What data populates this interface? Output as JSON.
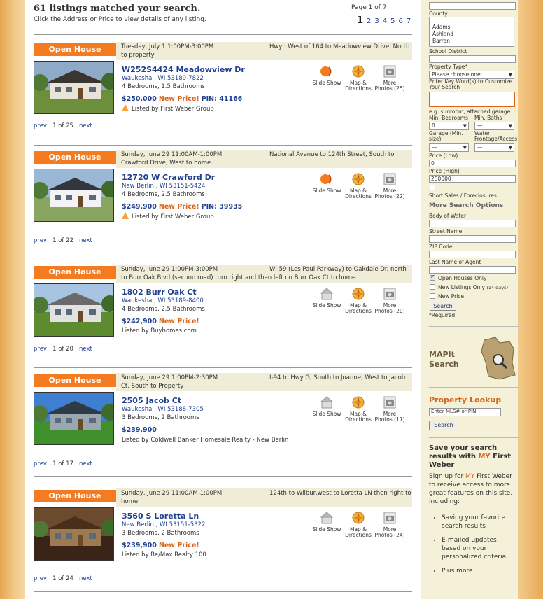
{
  "results": {
    "heading": "61 listings matched your search.",
    "instructions": "Click the Address or Price to view details of any listing.",
    "page_label": "Page 1 of 7",
    "pages": [
      "1",
      "2",
      "3",
      "4",
      "5",
      "6",
      "7"
    ],
    "current_page": "1"
  },
  "icons": {
    "slide_show": "Slide Show",
    "map": "Map & Directions",
    "more": "More Photos"
  },
  "listings": [
    {
      "badge": "Open House",
      "date": "Tuesday, July 1 1:00PM-3:00PM",
      "directions": "Hwy I West of 164 to Meadowview Drive, North to property",
      "address": "W252S4424 Meadowview Dr",
      "city": "Waukesha , WI 53189-7822",
      "beds": "4 Bedrooms, 1.5 Bathrooms",
      "price": "$250,000",
      "new_price": "New Price!",
      "pin": "PIN: 41166",
      "listed_by": "Listed by First Weber Group",
      "photo_count": "(25)",
      "prev": "prev",
      "count": "1 of 25",
      "next": "next"
    },
    {
      "badge": "Open House",
      "date": "Sunday, June 29 11:00AM-1:00PM",
      "directions": "National Avenue to 124th Street, South to Crawford Drive, West to home.",
      "address": "12720 W Crawford Dr",
      "city": "New Berlin , WI 53151-5424",
      "beds": "4 Bedrooms, 2.5 Bathrooms",
      "price": "$249,900",
      "new_price": "New Price!",
      "pin": "PIN: 39935",
      "listed_by": "Listed by First Weber Group",
      "photo_count": "(22)",
      "prev": "prev",
      "count": "1 of 22",
      "next": "next"
    },
    {
      "badge": "Open House",
      "date": "Sunday, June 29 1:00PM-3:00PM",
      "directions": "WI 59 (Les Paul Parkway) to Oakdale Dr. north to Burr Oak Blvd (second road) turn right and then left on Burr Oak Ct to home.",
      "address": "1802 Burr Oak Ct",
      "city": "Waukesha , WI 53189-8400",
      "beds": "4 Bedrooms, 2.5 Bathrooms",
      "price": "$242,900",
      "new_price": "New Price!",
      "pin": "",
      "listed_by": "Listed by Buyhomes.com",
      "photo_count": "(20)",
      "prev": "prev",
      "count": "1 of 20",
      "next": "next"
    },
    {
      "badge": "Open House",
      "date": "Sunday, June 29 1:00PM-2:30PM",
      "directions": "I-94 to Hwy G, South to Joanne, West to Jacob Ct, South to Property",
      "address": "2505 Jacob Ct",
      "city": "Waukesha , WI 53188-7305",
      "beds": "3 Bedrooms, 2 Bathrooms",
      "price": "$239,900",
      "new_price": "",
      "pin": "",
      "listed_by": "Listed by Coldwell Banker Homesale Realty - New Berlin",
      "photo_count": "(17)",
      "prev": "prev",
      "count": "1 of 17",
      "next": "next"
    },
    {
      "badge": "Open House",
      "date": "Sunday, June 29 11:00AM-1:00PM",
      "directions": "124th to Wilbur,west to Loretta LN then right to home.",
      "address": "3560 S Loretta Ln",
      "city": "New Berlin , WI 53151-5322",
      "beds": "3 Bedrooms, 2 Bathrooms",
      "price": "$239,900",
      "new_price": "New Price!",
      "pin": "",
      "listed_by": "Listed by Re/Max Realty 100",
      "photo_count": "(24)",
      "prev": "prev",
      "count": "1 of 24",
      "next": "next"
    }
  ],
  "sidebar": {
    "county_label": "County",
    "counties": [
      "Adams",
      "Ashland",
      "Barron"
    ],
    "school_label": "School District",
    "type_label": "Property Type*",
    "type_value": "Please choose one:",
    "keyword_label": "Enter Key Word(s) to Customize Your Search",
    "keyword_hint": "e.g. sunroom, attached garage",
    "min_bed_label": "Min. Bedrooms",
    "min_bath_label": "Min. Baths",
    "min_bed_value": "0",
    "min_bath_value": "—",
    "garage_label": "Garage (Min. size)",
    "water_label": "Water Frontage/Access",
    "garage_value": "—",
    "water_value": "—",
    "price_low_label": "Price (Low)",
    "price_low_value": "0",
    "price_high_label": "Price (High)",
    "price_high_value": "250000",
    "short_sales": "Short Sales / Foreclosures",
    "more_options": "More Search Options",
    "body_water": "Body of Water",
    "street": "Street Name",
    "zip": "ZIP Code",
    "agent": "Last Name of Agent",
    "open_houses": "Open Houses Only",
    "new_listings": "New Listings Only",
    "new_listings_days": "(14 days)",
    "new_price": "New Price",
    "search_btn": "Search",
    "required": "*Required",
    "mapit1": "MAPIt",
    "mapit2": "Search",
    "lookup_title": "Property Lookup",
    "lookup_placeholder": "Enter MLS# or PIN",
    "lookup_btn": "Search",
    "save_title1": "Save your search results with ",
    "save_my": "MY",
    "save_title2": " First Weber",
    "signup1": "Sign up for ",
    "signup_my": "MY",
    "signup2": " First Weber to receive access to more great features on this site, including:",
    "bullets": [
      "Saving your favorite search results",
      "E-mailed updates based on your personalized criteria",
      "Plus more"
    ]
  }
}
